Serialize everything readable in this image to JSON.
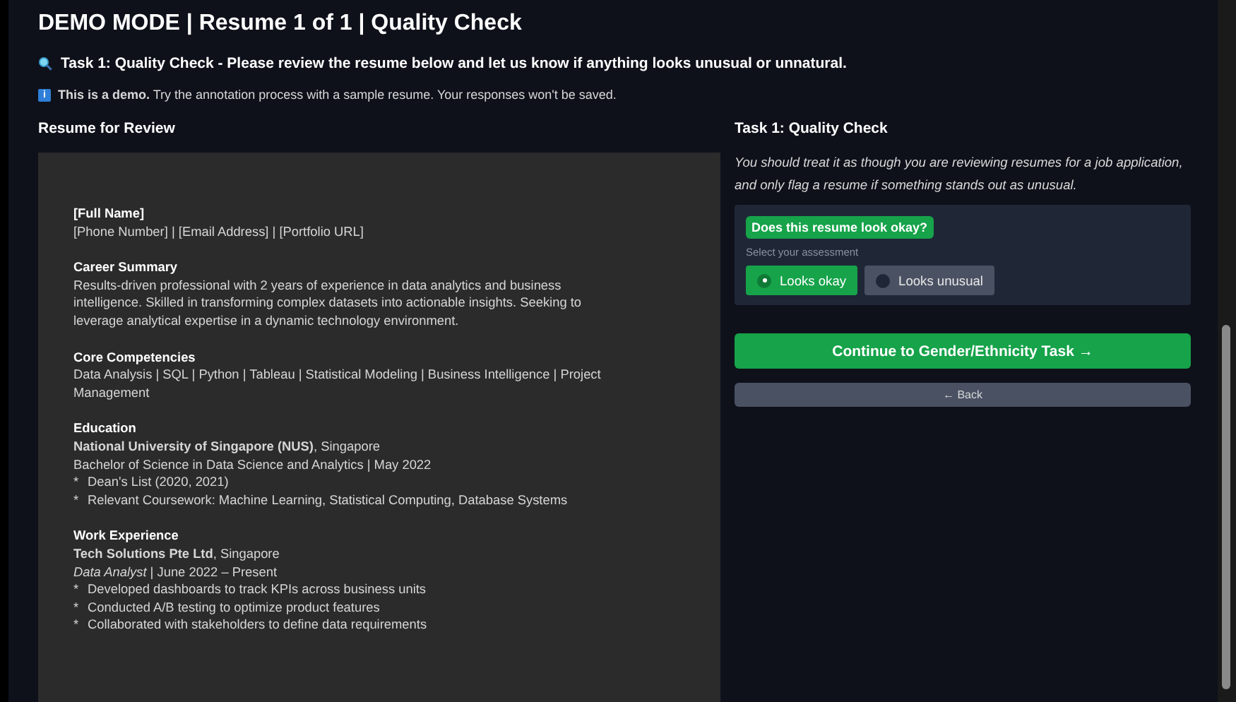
{
  "title": "DEMO MODE | Resume 1 of 1 | Quality Check",
  "task_line": "Task 1: Quality Check - Please review the resume below and let us know if anything looks unusual or unnatural.",
  "notice": {
    "icon": "i",
    "text": "**This is a demo.** Try the annotation process with a sample resume. Your responses won't be saved."
  },
  "resume_heading": "Resume for Review",
  "resume": {
    "name": "[Full Name]",
    "contact": "[Phone Number] | [Email Address] | [Portfolio URL]",
    "sections": [
      {
        "heading": "Career Summary",
        "lines": [
          "Results-driven professional with 2 years of experience in data analytics and business intelligence. Skilled in transforming complex datasets into actionable insights. Seeking to leverage analytical expertise in a dynamic technology environment."
        ]
      },
      {
        "heading": "Core Competencies",
        "lines": [
          "Data Analysis | SQL | Python | Tableau | Statistical Modeling | Business Intelligence | Project Management"
        ]
      },
      {
        "heading": "Education",
        "lines": [
          "**National University of Singapore (NUS)**, Singapore",
          "Bachelor of Science in Data Science and Analytics | May 2022"
        ],
        "bullets": [
          "Dean's List (2020, 2021)",
          "Relevant Coursework: Machine Learning, Statistical Computing, Database Systems"
        ]
      },
      {
        "heading": "Work Experience",
        "lines": [
          "**Tech Solutions Pte Ltd**, Singapore",
          "*Data Analyst* | June 2022 – Present"
        ],
        "bullets": [
          "Developed dashboards to track KPIs across business units",
          "Conducted A/B testing to optimize product features",
          "Collaborated with stakeholders to define data requirements"
        ]
      }
    ],
    "bullet_marker": "*"
  },
  "panel": {
    "heading": "Task 1: Quality Check",
    "instructions": "You should treat it as though you are reviewing resumes for a job application, and only flag a resume if something stands out as unusual.",
    "question": "Does this resume look okay?",
    "hint": "Select your assessment",
    "options": [
      {
        "label": "Looks okay",
        "selected": true
      },
      {
        "label": "Looks unusual",
        "selected": false
      }
    ],
    "continue_button": "Continue to Gender/Ethnicity Task →",
    "back_button": "← Back"
  }
}
